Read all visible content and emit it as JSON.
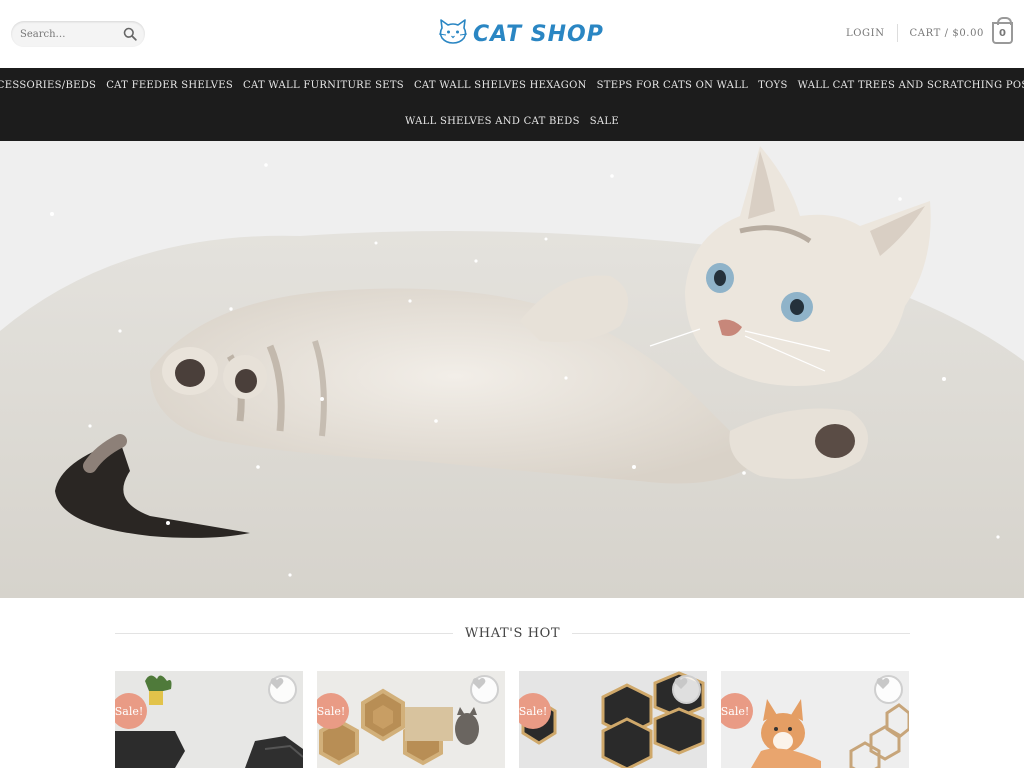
{
  "header": {
    "search": {
      "placeholder": "Search…",
      "icon": "search-icon"
    },
    "logo": {
      "text": "CAT SHOP",
      "icon": "cat-face-icon",
      "color": "#2a86c3"
    },
    "login_label": "LOGIN",
    "cart_label": "CART / $0.00",
    "cart_count": "0"
  },
  "nav": {
    "row1": [
      {
        "label": "ACCESSORIES/BEDS"
      },
      {
        "label": "CAT FEEDER SHELVES"
      },
      {
        "label": "CAT WALL FURNITURE SETS"
      },
      {
        "label": "CAT WALL SHELVES HEXAGON"
      },
      {
        "label": "STEPS FOR CATS ON WALL"
      },
      {
        "label": "TOYS"
      },
      {
        "label": "WALL CAT TREES AND SCRATCHING POSTS"
      }
    ],
    "row2": [
      {
        "label": "WALL SHELVES AND CAT BEDS"
      },
      {
        "label": "SALE"
      }
    ]
  },
  "hero": {
    "image": "kitten-lying-on-fluffy-rug"
  },
  "section": {
    "title": "WHAT'S HOT"
  },
  "products": [
    {
      "image": "black-hexagon-shelves-with-plant",
      "badge": "Sale!",
      "wishlist_icon": "heart-icon"
    },
    {
      "image": "wooden-hexagon-shelves-with-cat",
      "badge": "Sale!",
      "wishlist_icon": "heart-icon"
    },
    {
      "image": "hexagon-shelves-wall-set",
      "badge": "Sale!",
      "wishlist_icon": "heart-icon"
    },
    {
      "image": "ginger-cat-with-hexagon-shelves",
      "badge": "Sale!",
      "wishlist_icon": "heart-icon"
    }
  ],
  "colors": {
    "nav_bg": "#1c1c1c",
    "sale_badge": "#e99b85",
    "brand": "#2a86c3"
  }
}
